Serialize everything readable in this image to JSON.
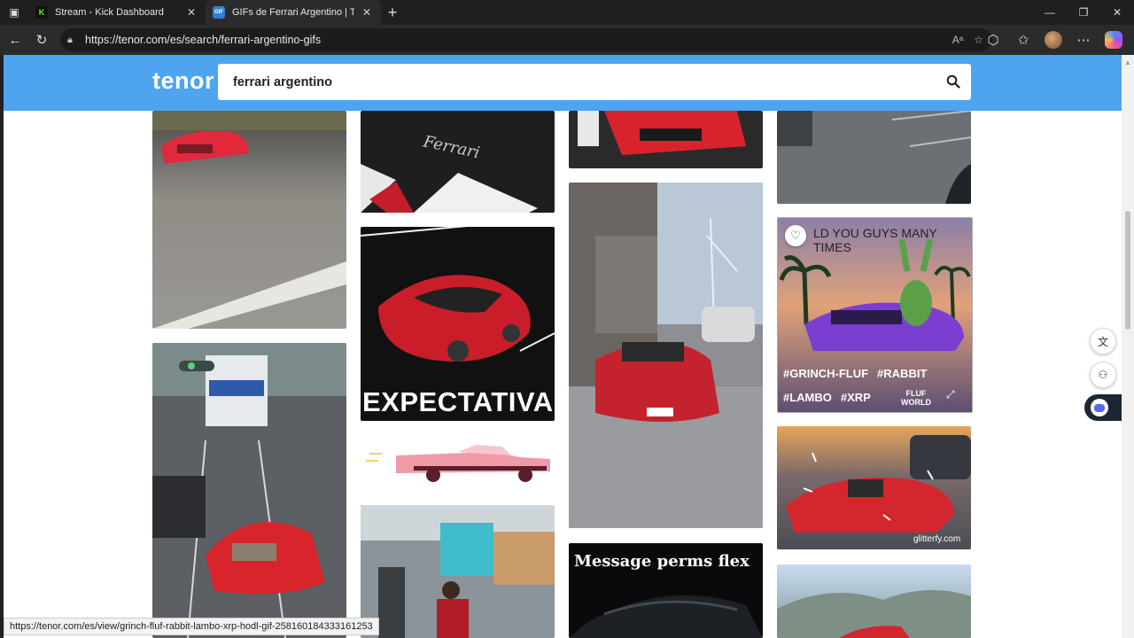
{
  "browser": {
    "tabs": [
      {
        "title": "Stream - Kick Dashboard",
        "favicon": "K",
        "active": false
      },
      {
        "title": "GIFs de Ferrari Argentino | Tenor",
        "favicon": "GIF",
        "active": true
      }
    ],
    "url": "https://tenor.com/es/search/ferrari-argentino-gifs",
    "status_url": "https://tenor.com/es/view/grinch-fluf-rabbit-lambo-xrp-hodl-gif-258160184333161253"
  },
  "tenor": {
    "logo": "tenor",
    "search_value": "ferrari argentino",
    "accent": "#4ea4ee"
  },
  "gifs": {
    "g1_text": "EXPECTATIVA",
    "g2_text": "Message perms flex",
    "featured": {
      "caption": "LD YOU GUYS MANY TIMES",
      "tags_row1": [
        "#GRINCH-FLUF",
        "#RABBIT"
      ],
      "tags_row2": [
        "#LAMBO",
        "#XRP"
      ],
      "watermark": "FLUF WORLD"
    },
    "glitterfy": "glitterfy.com"
  }
}
